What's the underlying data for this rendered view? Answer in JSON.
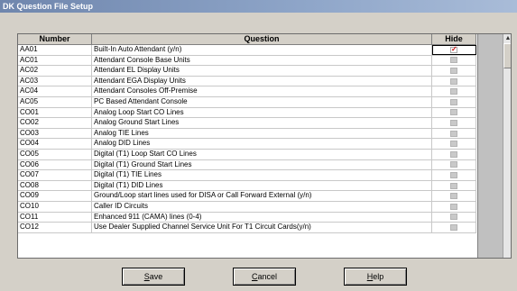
{
  "window": {
    "title": "DK Question File Setup"
  },
  "grid": {
    "columns": {
      "number": "Number",
      "question": "Question",
      "hide": "Hide"
    },
    "rows": [
      {
        "number": "AA01",
        "question": "Built-In Auto Attendant (y/n)",
        "hide": true
      },
      {
        "number": "AC01",
        "question": "Attendant Console Base Units",
        "hide": false
      },
      {
        "number": "AC02",
        "question": "Attendant EL Display Units",
        "hide": false
      },
      {
        "number": "AC03",
        "question": "Attendant EGA Display Units",
        "hide": false
      },
      {
        "number": "AC04",
        "question": "Attendant Consoles Off-Premise",
        "hide": false
      },
      {
        "number": "AC05",
        "question": "PC Based Attendant Console",
        "hide": false
      },
      {
        "number": "CO01",
        "question": "Analog Loop Start CO Lines",
        "hide": false
      },
      {
        "number": "CO02",
        "question": "Analog Ground Start Lines",
        "hide": false
      },
      {
        "number": "CO03",
        "question": "Analog TIE Lines",
        "hide": false
      },
      {
        "number": "CO04",
        "question": "Analog DID Lines",
        "hide": false
      },
      {
        "number": "CO05",
        "question": "Digital (T1) Loop Start CO Lines",
        "hide": false
      },
      {
        "number": "CO06",
        "question": "Digital (T1) Ground Start Lines",
        "hide": false
      },
      {
        "number": "CO07",
        "question": "Digital (T1) TIE Lines",
        "hide": false
      },
      {
        "number": "CO08",
        "question": "Digital (T1) DID Lines",
        "hide": false
      },
      {
        "number": "CO09",
        "question": "Ground/Loop start lines used for DISA or Call Forward External (y/n)",
        "hide": false
      },
      {
        "number": "CO10",
        "question": "Caller ID Circuits",
        "hide": false
      },
      {
        "number": "CO11",
        "question": "Enhanced 911 (CAMA) lines (0-4)",
        "hide": false
      },
      {
        "number": "CO12",
        "question": "Use Dealer Supplied Channel Service Unit For T1 Circuit Cards(y/n)",
        "hide": false
      }
    ]
  },
  "buttons": {
    "save": {
      "accel": "S",
      "rest": "ave"
    },
    "cancel": {
      "accel": "C",
      "rest": "ancel"
    },
    "help": {
      "accel": "H",
      "rest": "elp"
    }
  }
}
